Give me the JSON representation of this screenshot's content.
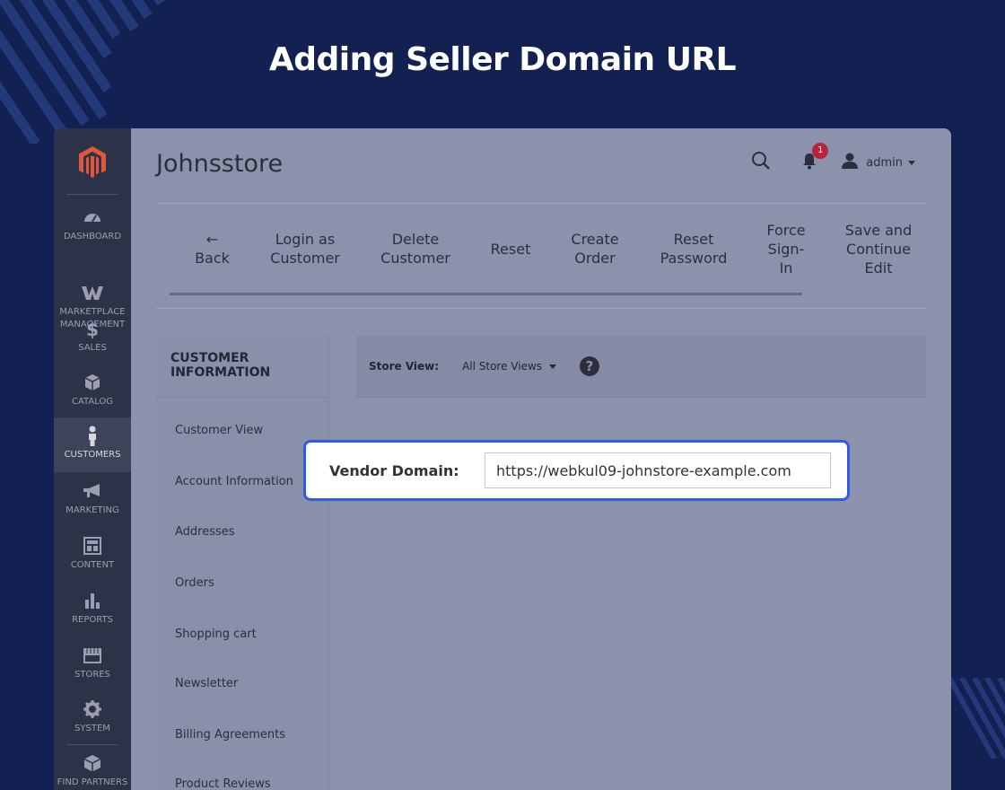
{
  "banner": {
    "title": "Adding Seller Domain URL"
  },
  "header": {
    "store_title": "Johnsstore",
    "notification_count": "1",
    "user_name": "admin"
  },
  "sidebar": {
    "items": [
      {
        "label": "DASHBOARD",
        "icon": "dashboard-icon"
      },
      {
        "label": "MARKETPLACE\nMANAGEMENT",
        "icon": "marketplace-icon"
      },
      {
        "label": "SALES",
        "icon": "dollar-icon"
      },
      {
        "label": "CATALOG",
        "icon": "box-icon"
      },
      {
        "label": "CUSTOMERS",
        "icon": "person-icon",
        "active": true
      },
      {
        "label": "MARKETING",
        "icon": "megaphone-icon"
      },
      {
        "label": "CONTENT",
        "icon": "layout-icon"
      },
      {
        "label": "REPORTS",
        "icon": "bar-chart-icon"
      },
      {
        "label": "STORES",
        "icon": "store-icon"
      },
      {
        "label": "SYSTEM",
        "icon": "gear-icon"
      },
      {
        "label": "FIND PARTNERS",
        "icon": "partners-icon"
      }
    ]
  },
  "toolbar": {
    "back_arrow": "←",
    "back": "Back",
    "login_as_customer": "Login as\nCustomer",
    "delete_customer": "Delete\nCustomer",
    "reset": "Reset",
    "create_order": "Create\nOrder",
    "reset_password": "Reset\nPassword",
    "force_sign_in": "Force\nSign-\nIn",
    "save_and_continue": "Save and\nContinue\nEdit"
  },
  "customer_info": {
    "heading": "CUSTOMER\nINFORMATION",
    "items": [
      "Customer View",
      "Account Information",
      "Addresses",
      "Orders",
      "Shopping cart",
      "Newsletter",
      "Billing Agreements",
      "Product Reviews"
    ]
  },
  "store_view": {
    "label": "Store View:",
    "selected": "All Store Views",
    "help": "?"
  },
  "vendor_domain": {
    "label": "Vendor Domain:",
    "value": "https://webkul09-johnstore-example.com"
  },
  "colors": {
    "background": "#132152",
    "highlight_border": "#2d5be3",
    "sidebar": "#2c3247",
    "logo": "#e2563b",
    "badge": "#b7223d"
  }
}
